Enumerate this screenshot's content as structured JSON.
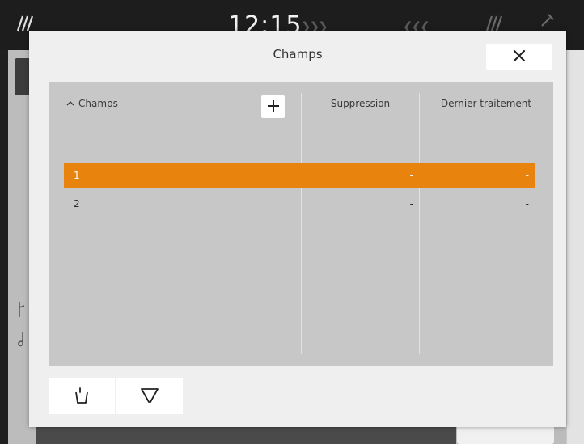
{
  "statusbar": {
    "time": "12:15"
  },
  "dialog": {
    "title": "Champs",
    "columns": {
      "name": "Champs",
      "suppression": "Suppression",
      "dernier": "Dernier traitement"
    },
    "rows": [
      {
        "name": "1",
        "suppression": "-",
        "dernier": "-",
        "selected": true
      },
      {
        "name": "2",
        "suppression": "-",
        "dernier": "-",
        "selected": false
      }
    ]
  },
  "icons": {
    "close": "close-icon",
    "add": "plus-icon",
    "sort": "chevron-up-icon",
    "select_tool": "bucket-select-icon",
    "filter": "filter-icon"
  },
  "colors": {
    "selected_row": "#e8830d",
    "dialog_bg": "#efefef",
    "panel_bg": "#c7c7c7"
  }
}
